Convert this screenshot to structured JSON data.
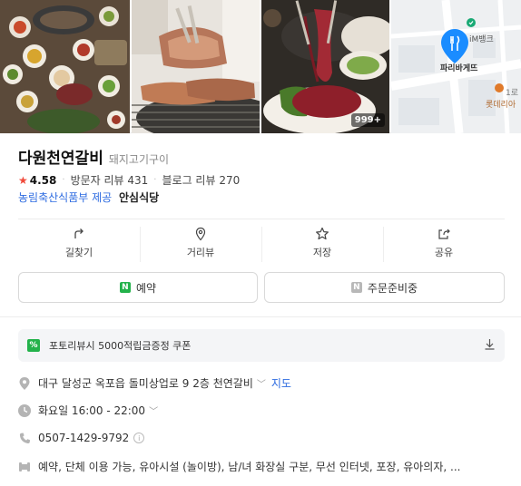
{
  "photos": {
    "count_badge": "999+",
    "map": {
      "bank_label": "iM뱅크",
      "store_label": "파리바게뜨",
      "store2_label": "롯데리아",
      "road_label": "1로"
    }
  },
  "place": {
    "name": "다원천연갈비",
    "category": "돼지고기구이",
    "rating": "4.58",
    "visitor_reviews": "방문자 리뷰 431",
    "blog_reviews": "블로그 리뷰 270",
    "provider": "농림축산식품부 제공",
    "provider_badge": "안심식당"
  },
  "actions": [
    {
      "label": "길찾기"
    },
    {
      "label": "거리뷰"
    },
    {
      "label": "저장"
    },
    {
      "label": "공유"
    }
  ],
  "buttons": {
    "reserve": "예약",
    "order": "주문준비중"
  },
  "coupon": {
    "text": "포토리뷰시 5000적립금증정 쿠폰"
  },
  "info": {
    "address": "대구 달성군 옥포읍 돌미상업로 9 2층 천연갈비",
    "map_link": "지도",
    "hours": "화요일 16:00 - 22:00",
    "phone": "0507-1429-9792",
    "amenities": "예약, 단체 이용 가능, 유아시설 (놀이방), 남/녀 화장실 구분, 무선 인터넷, 포장, 유아의자, ..."
  },
  "colors": {
    "accent_blue": "#2d6be0",
    "star_red": "#f04a3a",
    "naver_green": "#23b24b",
    "map_pin": "#1a8cff"
  }
}
